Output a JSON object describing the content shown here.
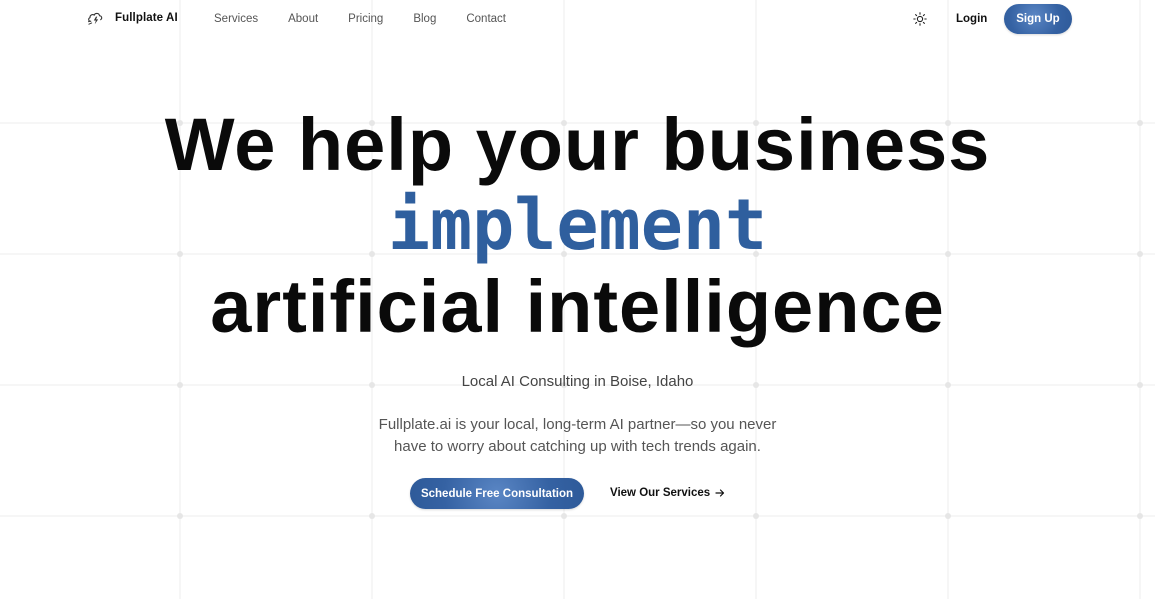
{
  "brand": {
    "name": "Fullplate AI",
    "logo_icon": "lightning-cloud-icon"
  },
  "nav": {
    "links": [
      "Services",
      "About",
      "Pricing",
      "Blog",
      "Contact"
    ],
    "theme_toggle_icon": "sun-icon",
    "login_label": "Login",
    "signup_label": "Sign Up"
  },
  "hero": {
    "line1": "We help your business",
    "line2": "implement",
    "line3": "artificial intelligence",
    "subtitle": "Local AI Consulting in Boise, Idaho",
    "description_line1": "Fullplate.ai is your local, long-term AI partner—so you never",
    "description_line2": "have to worry about catching up with tech trends again.",
    "primary_cta": "Schedule Free Consultation",
    "secondary_cta": "View Our Services",
    "secondary_cta_icon": "arrow-right-icon"
  },
  "colors": {
    "accent": "#2f5f9e",
    "button": "#3562a3",
    "text": "#0a0a0a",
    "grid": "#ececec"
  }
}
